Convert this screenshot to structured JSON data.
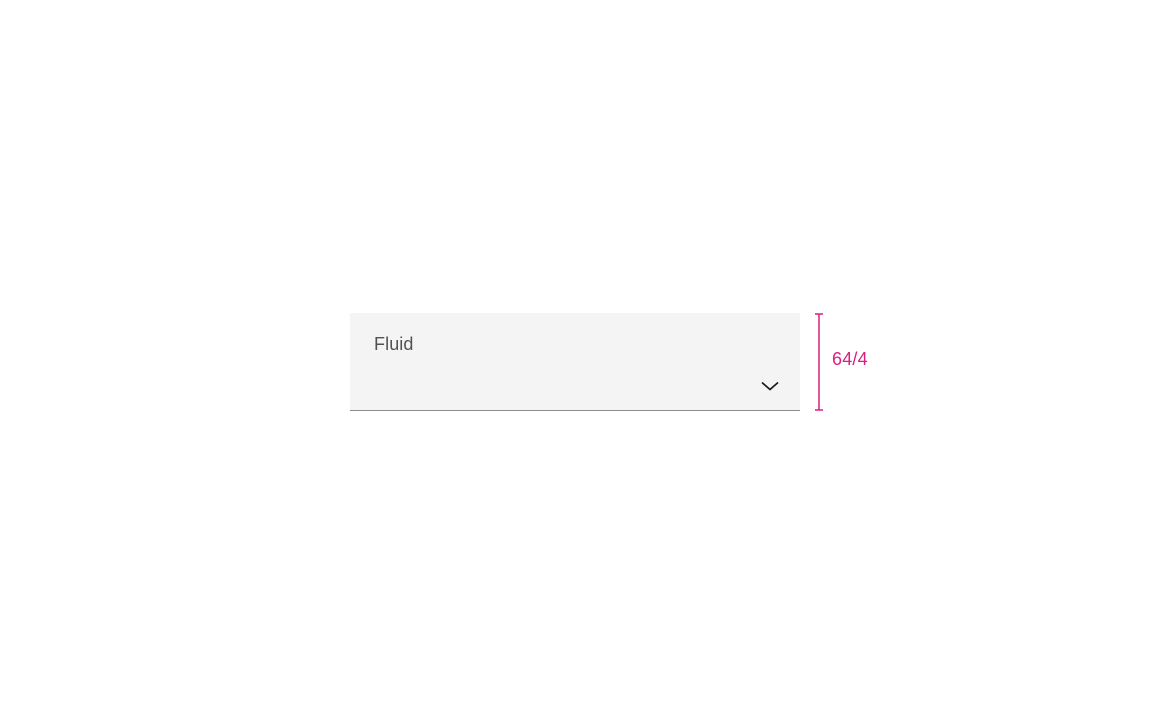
{
  "dropdown": {
    "label": "Fluid"
  },
  "spec": {
    "height_label": "64/4"
  },
  "colors": {
    "spec_accent": "#da1e82",
    "field_bg": "#f4f4f4",
    "border": "#8d8d8d",
    "text_secondary": "#525252"
  }
}
